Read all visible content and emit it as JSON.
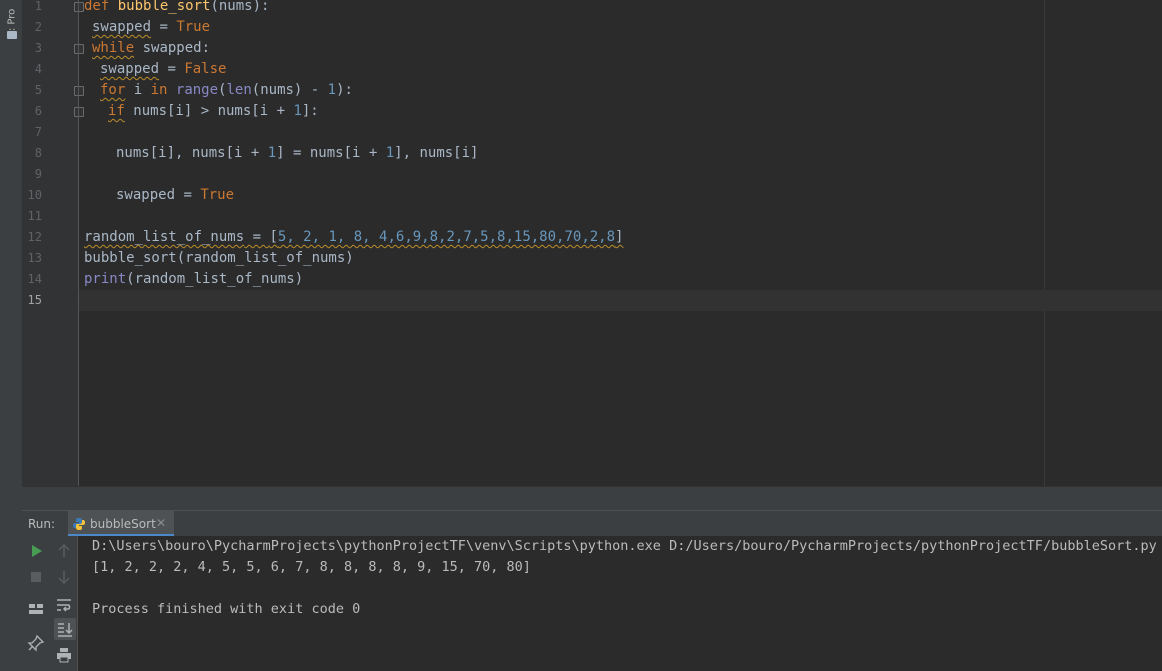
{
  "toolwindow": {
    "project_tab_label": "1: Pro"
  },
  "editor": {
    "line_numbers": [
      "1",
      "2",
      "3",
      "4",
      "5",
      "6",
      "7",
      "8",
      "9",
      "10",
      "11",
      "12",
      "13",
      "14",
      "15"
    ],
    "current_line": "15"
  },
  "code": {
    "l1": {
      "kw": "def",
      "fn": "bubble_sort",
      "rest": "(nums):"
    },
    "l2": {
      "var": "swapped",
      "eq": " = ",
      "val": "True"
    },
    "l3": {
      "kw": "while",
      "rest": " swapped:"
    },
    "l4": {
      "var": "swapped",
      "eq": " = ",
      "val": "False"
    },
    "l5": {
      "kw": "for",
      "a": " i ",
      "kw2": "in",
      "sp": " ",
      "bi": "range",
      "b": "(",
      "bi2": "len",
      "c": "(nums) - ",
      "num": "1",
      "d": "):"
    },
    "l6": {
      "kw": "if",
      "a": " nums[i] > nums[i + ",
      "num": "1",
      "b": "]:"
    },
    "l8": {
      "a": "nums[i], nums[i + ",
      "n1": "1",
      "b": "] = nums[i + ",
      "n2": "1",
      "c": "], nums[i]"
    },
    "l10": {
      "var": "swapped",
      "eq": " = ",
      "val": "True"
    },
    "l12": {
      "var": "random_list_of_nums",
      "eq": " = ",
      "open": "[",
      "nums": "5, 2, 1, 8, 4,6,9,8,2,7,5,8,15,80,70,2,8",
      "close": "]"
    },
    "l13": {
      "text": "bubble_sort(random_list_of_nums)"
    },
    "l14": {
      "bi": "print",
      "rest": "(random_list_of_nums)"
    }
  },
  "run": {
    "label": "Run:",
    "tab_name": "bubbleSort",
    "tab_close": "✕",
    "output": [
      "D:\\Users\\bouro\\PycharmProjects\\pythonProjectTF\\venv\\Scripts\\python.exe D:/Users/bouro/PycharmProjects/pythonProjectTF/bubbleSort.py",
      "[1, 2, 2, 2, 4, 5, 5, 6, 7, 8, 8, 8, 8, 9, 15, 70, 80]",
      "",
      "Process finished with exit code 0"
    ]
  },
  "colors": {
    "keyword": "#cc7832",
    "function": "#ffc66d",
    "number": "#6897bb",
    "builtin": "#8888c6",
    "text": "#a9b7c6",
    "run_green": "#499c54"
  }
}
